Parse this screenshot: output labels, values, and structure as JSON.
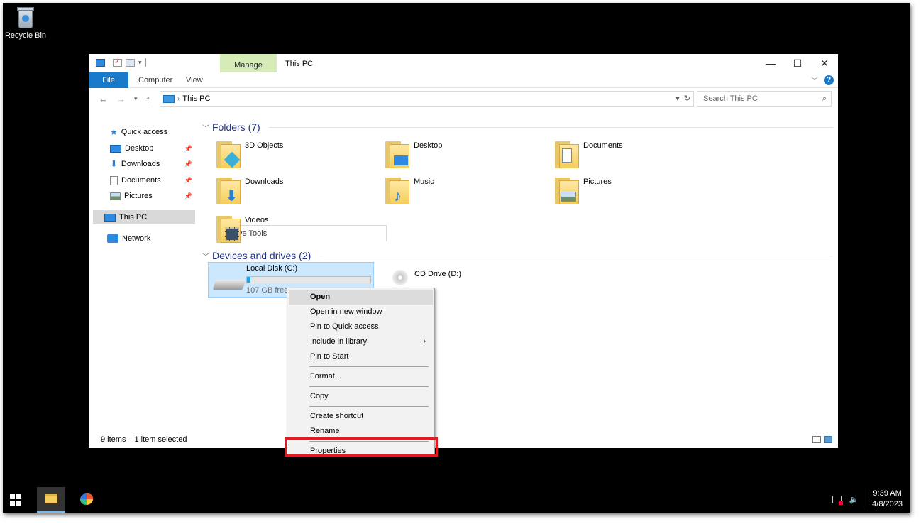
{
  "desktop": {
    "recycle_bin_label": "Recycle Bin"
  },
  "window": {
    "title": "This PC",
    "contextual_tab": "Manage",
    "controls": {
      "minimize": "—",
      "maximize": "☐",
      "close": "✕"
    }
  },
  "ribbon": {
    "tabs": [
      "File",
      "Computer",
      "View",
      "Drive Tools"
    ],
    "help": "?"
  },
  "address": {
    "path": "This PC",
    "search_placeholder": "Search This PC"
  },
  "nav": {
    "quick_access": "Quick access",
    "items": [
      "Desktop",
      "Downloads",
      "Documents",
      "Pictures"
    ],
    "this_pc": "This PC",
    "network": "Network"
  },
  "content": {
    "folders_header": "Folders (7)",
    "folders": [
      "3D Objects",
      "Desktop",
      "Documents",
      "Downloads",
      "Music",
      "Pictures",
      "Videos"
    ],
    "devices_header": "Devices and drives (2)",
    "local_disk": {
      "name": "Local Disk (C:)",
      "free": "107 GB free",
      "used_fraction": 0.03
    },
    "cd_drive": {
      "name": "CD Drive (D:)"
    }
  },
  "status": {
    "items": "9 items",
    "selected": "1 item selected"
  },
  "context_menu": {
    "items": [
      "Open",
      "Open in new window",
      "Pin to Quick access",
      "Include in library",
      "Pin to Start",
      "Format...",
      "Copy",
      "Create shortcut",
      "Rename",
      "Properties"
    ]
  },
  "taskbar": {
    "time": "9:39 AM",
    "date": "4/8/2023"
  },
  "colors": {
    "accent": "#1979ca",
    "highlight_box": "#e01b24",
    "selection": "#cce8ff"
  }
}
